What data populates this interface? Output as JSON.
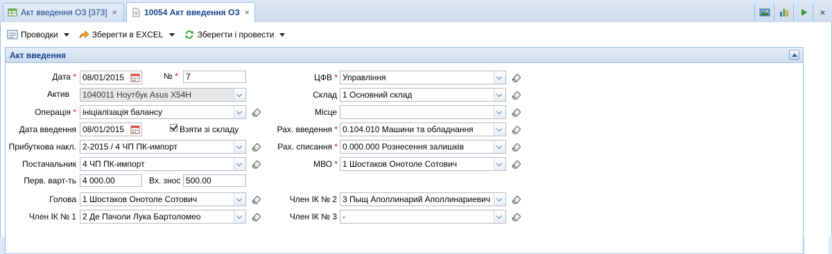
{
  "tabs": [
    {
      "label": "Акт введення ОЗ [373]",
      "close": "×"
    },
    {
      "label": "10054 Акт введення ОЗ",
      "close": "×"
    }
  ],
  "window_close": "×",
  "toolbar": {
    "postings_label": "Проводки",
    "excel_label": "Зберегти в EXCEL",
    "save_post_label": "Зберегти і провести"
  },
  "fieldset": {
    "title": "Акт введення"
  },
  "form": {
    "date": {
      "label": "Дата",
      "value": "08/01/2015"
    },
    "number": {
      "label": "№",
      "value": "7"
    },
    "asset": {
      "label": "Актив",
      "value": "1040011 Ноутбук Asus X54H"
    },
    "operation": {
      "label": "Операція",
      "value": "ініціалізація балансу"
    },
    "intro_date": {
      "label": "Дата введення",
      "value": "08/01/2015"
    },
    "take_from_stock": {
      "label": "Взяти зі складу",
      "checked": true
    },
    "receipt_invoice": {
      "label": "Прибуткова накл.",
      "value": "2-2015 / 4 ЧП ПК-импорт"
    },
    "supplier": {
      "label": "Постачальник",
      "value": "4 ЧП ПК-импорт"
    },
    "initial_cost": {
      "label": "Перв. варт-ть",
      "value": "4 000.00"
    },
    "depreciation": {
      "label": "Вх. знос",
      "value": "500.00"
    },
    "chairman": {
      "label": "Голова",
      "value": "1 Шостаков Онотоле Сотович"
    },
    "member1": {
      "label": "Член ІК № 1",
      "value": "2 Де Пачоли Лука Бартоломео"
    },
    "cfv": {
      "label": "ЦФВ",
      "value": "Управління"
    },
    "warehouse": {
      "label": "Склад",
      "value": "1 Основний склад"
    },
    "place": {
      "label": "Місце",
      "value": ""
    },
    "account_intro": {
      "label": "Рах. введення",
      "value": "0.104.010 Машини та обладнання"
    },
    "account_writeoff": {
      "label": "Рах. списання",
      "value": "0.000.000 Рознесення залишків"
    },
    "mvo": {
      "label": "МВО",
      "value": "1 Шостаков Онотоле Сотович"
    },
    "member2": {
      "label": "Член ІК № 2",
      "value": "3 Пыщ Аполлинарий Аполлинариевич"
    },
    "member3": {
      "label": "Член ІК № 3",
      "value": "-"
    }
  },
  "required_mark": "*"
}
